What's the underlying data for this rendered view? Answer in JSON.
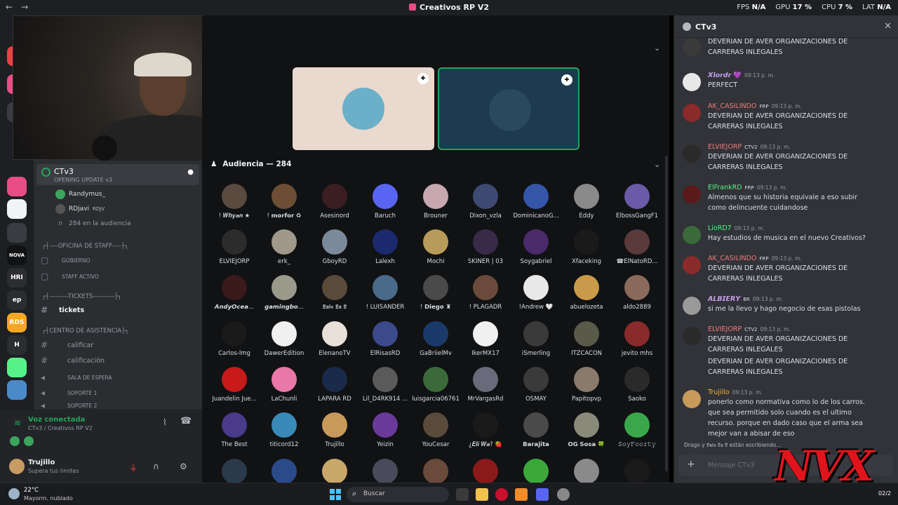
{
  "titlebar": {
    "title": "Creativos RP V2",
    "back": "←",
    "forward": "→",
    "fps_label": "FPS",
    "fps_value": "N/A",
    "gpu_label": "GPU",
    "gpu_value": "17 %",
    "cpu_label": "CPU",
    "cpu_value": "7 %",
    "lat_label": "LAT",
    "lat_value": "N/A"
  },
  "rail": {
    "items": [
      {
        "label": "NOVA",
        "color": "#111214"
      },
      {
        "label": "HRI",
        "color": "#2b2d31"
      },
      {
        "label": "ep",
        "color": "#2b2d31"
      },
      {
        "label": "RDS",
        "color": "#f5a623"
      },
      {
        "label": "H",
        "color": "#2b2d31"
      }
    ]
  },
  "sidebar": {
    "voice_channel": {
      "name": "CTv3",
      "subtitle": "OPENING UPDATE v3",
      "users": [
        {
          "name": "Randymus_",
          "badge": ""
        },
        {
          "name": "RDjavi",
          "badge": "RDJV"
        }
      ],
      "audience": "284 en la audiencia"
    },
    "categories": {
      "staff": "┌┤----OFICINA DE STAFF----├┐",
      "tickets": "┌┤---------TICKETS----------├┐",
      "support": "┌┤CENTRO DE ASISTENCIA├┐"
    },
    "channels": {
      "gobierno": "GOBIERNO",
      "staff_activo": "STAFF ACTIVO",
      "tickets": "tickets",
      "calificar": "calificar",
      "calificacion": "calificación",
      "sala_espera": "SALA DE ESPERA",
      "soporte1": "SOPORTE 1",
      "soporte2": "SOPORTE 2"
    },
    "voice_status": {
      "title": "Voz conectada",
      "sub": "CTv3 / Creativos RP V2"
    },
    "user": {
      "name": "Trujillo",
      "status": "Supera tus limites"
    }
  },
  "stage": {
    "audience_header": "Audiencia — 284",
    "audience": [
      {
        "name": "! 𝑾𝒉𝒚𝒂𝒏 ★",
        "color": "#5b4a3f"
      },
      {
        "name": "! 𝗺𝗼𝗿𝗳𝗼𝗿 ♻",
        "color": "#6b4e33"
      },
      {
        "name": "Asesinord",
        "color": "#3a1e22"
      },
      {
        "name": "Baruch",
        "color": "#5865f2"
      },
      {
        "name": "Brouner",
        "color": "#c8a8b0"
      },
      {
        "name": "Dixon_vzla",
        "color": "#3e4a72"
      },
      {
        "name": "DominicanoG...",
        "color": "#3556a8"
      },
      {
        "name": "Eddy",
        "color": "#8a8a8a"
      },
      {
        "name": "ElbossGangF1",
        "color": "#6a5aa8"
      },
      {
        "name": "ELVIEJORP",
        "color": "#2c2c2c"
      },
      {
        "name": "erk_",
        "color": "#a0988a"
      },
      {
        "name": "GboyRD",
        "color": "#7a8a9a"
      },
      {
        "name": "Lalexh",
        "color": "#1b2a6e"
      },
      {
        "name": "Mochi",
        "color": "#b89a5a"
      },
      {
        "name": "SKINER | 03",
        "color": "#3a2a4a"
      },
      {
        "name": "Soygabriel",
        "color": "#4a2a6a"
      },
      {
        "name": "Xfaceking",
        "color": "#1a1a1a"
      },
      {
        "name": "☎ElNatoRD...",
        "color": "#5a3a3a"
      },
      {
        "name": "𝘼𝙣𝙙𝙮𝙊𝙘𝙚𝙖...",
        "color": "#3a1a1a"
      },
      {
        "name": "𝙜𝙖𝙢𝙞𝙣𝙜𝙗𝙤...",
        "color": "#9a9a8a"
      },
      {
        "name": "𝕷𝖚𝖎𝖘 𝕷𝖆 𝕷",
        "color": "#5a4a3a"
      },
      {
        "name": "! LUISANDER",
        "color": "#4a6a8a"
      },
      {
        "name": "! 𝗗𝗶𝗲𝗴𝗼 ♜",
        "color": "#4a4a4a"
      },
      {
        "name": "! PLAGADR",
        "color": "#6a4a3a"
      },
      {
        "name": "!Andrew 🤍",
        "color": "#e8e8e8"
      },
      {
        "name": "abuelozeta",
        "color": "#c89a4a"
      },
      {
        "name": "aldo2889",
        "color": "#8a6a5a"
      },
      {
        "name": "Carlos-lmg",
        "color": "#1a1a1a"
      },
      {
        "name": "DawerEdition",
        "color": "#f0f0f0"
      },
      {
        "name": "ElenanoTV",
        "color": "#e8e0d8"
      },
      {
        "name": "ElRisasRD",
        "color": "#3a4a8a"
      },
      {
        "name": "GaBriielMv",
        "color": "#1a3a6a"
      },
      {
        "name": "IkerMX17",
        "color": "#f0f0f0"
      },
      {
        "name": "iSmerling",
        "color": "#3a3a3a"
      },
      {
        "name": "ITZCACON",
        "color": "#5a5a4a"
      },
      {
        "name": "jevito mhs",
        "color": "#8a2a2a"
      },
      {
        "name": "Juandelin Jue...",
        "color": "#c81a1a"
      },
      {
        "name": "LaChunli",
        "color": "#e878a8"
      },
      {
        "name": "LAPARA RD",
        "color": "#1a2a4a"
      },
      {
        "name": "Lil_D4RK914 ...",
        "color": "#5a5a5a"
      },
      {
        "name": "luisgarcia06761",
        "color": "#3a6a3a"
      },
      {
        "name": "MrVargasRd",
        "color": "#6a6a7a"
      },
      {
        "name": "OSMAY",
        "color": "#3a3a3a"
      },
      {
        "name": "Papitopvp",
        "color": "#8a7a6a"
      },
      {
        "name": "Saoko",
        "color": "#2a2a2a"
      },
      {
        "name": "The Best",
        "color": "#4a3a8a"
      },
      {
        "name": "titicord12",
        "color": "#3a8ab8"
      },
      {
        "name": "Trujillo",
        "color": "#c89a5a"
      },
      {
        "name": "Yeizin",
        "color": "#6a3a9a"
      },
      {
        "name": "YouCesar",
        "color": "#5a4a3a"
      },
      {
        "name": "¿𝑬𝒍𝒊 𝑾𝒂? 🍓",
        "color": "#1a1a1a"
      },
      {
        "name": "𝗕𝗮𝗿𝗮𝗷𝗶𝘁𝗮",
        "color": "#4a4a4a"
      },
      {
        "name": "𝗢𝗚 𝗦𝗼𝘀𝗮 🍀",
        "color": "#8a8a7a"
      },
      {
        "name": "𝚂𝚘𝚢𝙵𝚘𝚘𝚛𝚝𝚢",
        "color": "#3aa84a"
      },
      {
        "name": "",
        "color": "#2a3a4a"
      },
      {
        "name": "",
        "color": "#2a4a8a"
      },
      {
        "name": "",
        "color": "#c8a86a"
      },
      {
        "name": "",
        "color": "#4a4a5a"
      },
      {
        "name": "",
        "color": "#6a4a3a"
      },
      {
        "name": "",
        "color": "#8a1a1a"
      },
      {
        "name": "",
        "color": "#3aa83a"
      },
      {
        "name": "",
        "color": "#8a8a8a"
      },
      {
        "name": "",
        "color": "#1a1a1a"
      }
    ]
  },
  "chat": {
    "title": "CTv3",
    "messages": [
      {
        "user": "",
        "color": "#dbdee1",
        "tag": "",
        "time": "",
        "lines": [
          "DEVERIAN DE AVER ORGANIZACIONES DE CARRERAS INLEGALES"
        ],
        "avatar": "#3a3a3a"
      },
      {
        "user": "𝙓𝙡𝙤𝙧𝙙𝙧 💜",
        "color": "#c9a0f0",
        "tag": "",
        "time": "09:13 p. m.",
        "lines": [
          "PERFECT"
        ],
        "avatar": "#e8e8e8"
      },
      {
        "user": "AK_CASILINDO",
        "color": "#f07a7a",
        "tag": "FRP",
        "time": "09:13 p. m.",
        "lines": [
          "DEVERIAN DE AVER ORGANIZACIONES DE CARRERAS INLEGALES"
        ],
        "avatar": "#8a2a2a"
      },
      {
        "user": "ELVIEJORP",
        "color": "#f07a7a",
        "tag": "CTV2",
        "time": "09:13 p. m.",
        "lines": [
          "DEVERIAN DE AVER ORGANIZACIONES DE CARRERAS INLEGALES"
        ],
        "avatar": "#2a2a2a"
      },
      {
        "user": "ElFrankRD",
        "color": "#57f287",
        "tag": "FRP",
        "time": "09:13 p. m.",
        "lines": [
          "Almenos que su historia equivale a eso subir como delincuente cuidandose"
        ],
        "avatar": "#5a1a1a"
      },
      {
        "user": "LioRD7",
        "color": "#57f287",
        "tag": "",
        "time": "09:13 p. m.",
        "lines": [
          "Hay estudios de musica en el nuevo Creativos?"
        ],
        "avatar": "#3a6a3a"
      },
      {
        "user": "AK_CASILINDO",
        "color": "#f07a7a",
        "tag": "FRP",
        "time": "09:13 p. m.",
        "lines": [
          "DEVERIAN DE AVER ORGANIZACIONES DE CARRERAS INLEGALES"
        ],
        "avatar": "#8a2a2a"
      },
      {
        "user": "𝘼𝙇𝘽𝙄𝙀𝙍𝙔",
        "color": "#c9a0f0",
        "tag": "BR",
        "time": "09:13 p. m.",
        "lines": [
          "si me la llevo y hago negocio de esas pistolas"
        ],
        "avatar": "#9a9a9a"
      },
      {
        "user": "ELVIEJORP",
        "color": "#f07a7a",
        "tag": "CTV2",
        "time": "09:13 p. m.",
        "lines": [
          "DEVERIAN DE AVER ORGANIZACIONES DE CARRERAS INLEGALES",
          "DEVERIAN DE AVER ORGANIZACIONES DE CARRERAS INLEGALES"
        ],
        "avatar": "#2a2a2a"
      },
      {
        "user": "Trujillo",
        "color": "#f0b232",
        "tag": "",
        "time": "09:13 p. m.",
        "lines": [
          "ponerlo como normativa como lo de los carros. que sea permitido solo cuando es el ultimo recurso. porque en dado caso que el arma sea mejor van a abisar de eso"
        ],
        "avatar": "#c89a5a"
      }
    ],
    "typing": "Drago y 𝕷𝖚𝖎𝖘 𝕷𝖆 𝕷 están escribiendo...",
    "input_placeholder": "Mensaje CTv3"
  },
  "overlay_logo": "NVX",
  "taskbar": {
    "temp": "22°C",
    "weather": "Mayorm. nublado",
    "search": "Buscar",
    "clock": "02/2"
  }
}
